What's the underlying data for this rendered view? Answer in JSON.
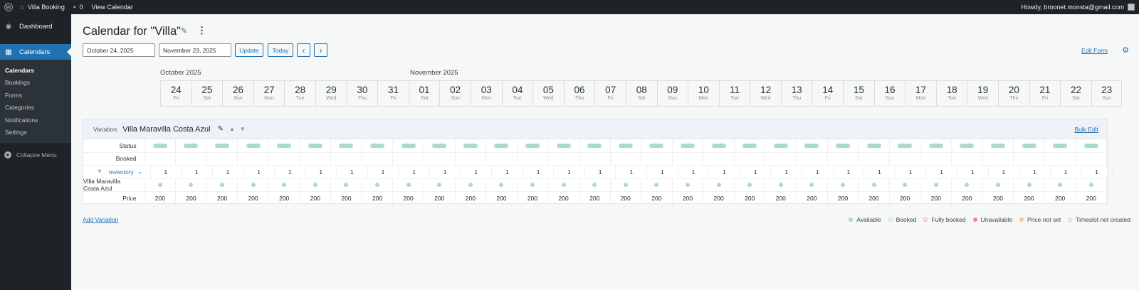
{
  "adminbar": {
    "site_name": "Villa Booking",
    "comments_count": "0",
    "view_calendar": "View Calendar",
    "howdy": "Howdy, broonet.monsta@gmail.com"
  },
  "sidebar": {
    "dashboard": "Dashboard",
    "calendars": "Calendars",
    "submenu": [
      "Calendars",
      "Bookings",
      "Forms",
      "Categories",
      "Notifications",
      "Settings"
    ],
    "collapse": "Collapse Menu"
  },
  "page": {
    "title": "Calendar for \"Villa\"",
    "start_date": "October 24, 2025",
    "end_date": "November 23, 2025",
    "update_label": "Update",
    "today_label": "Today",
    "prev_label": "‹",
    "next_label": "›",
    "edit_form": "Edit Form",
    "months": [
      "October 2025",
      "November 2025"
    ]
  },
  "days": [
    {
      "num": "24",
      "wd": "Fri"
    },
    {
      "num": "25",
      "wd": "Sat"
    },
    {
      "num": "26",
      "wd": "Sun"
    },
    {
      "num": "27",
      "wd": "Mon"
    },
    {
      "num": "28",
      "wd": "Tue"
    },
    {
      "num": "29",
      "wd": "Wed"
    },
    {
      "num": "30",
      "wd": "Thu"
    },
    {
      "num": "31",
      "wd": "Fri"
    },
    {
      "num": "01",
      "wd": "Sat"
    },
    {
      "num": "02",
      "wd": "Sun"
    },
    {
      "num": "03",
      "wd": "Mon"
    },
    {
      "num": "04",
      "wd": "Tue"
    },
    {
      "num": "05",
      "wd": "Wed"
    },
    {
      "num": "06",
      "wd": "Thu"
    },
    {
      "num": "07",
      "wd": "Fri"
    },
    {
      "num": "08",
      "wd": "Sat"
    },
    {
      "num": "09",
      "wd": "Sun"
    },
    {
      "num": "10",
      "wd": "Mon"
    },
    {
      "num": "11",
      "wd": "Tue"
    },
    {
      "num": "12",
      "wd": "Wed"
    },
    {
      "num": "13",
      "wd": "Thu"
    },
    {
      "num": "14",
      "wd": "Fri"
    },
    {
      "num": "15",
      "wd": "Sat"
    },
    {
      "num": "16",
      "wd": "Sun"
    },
    {
      "num": "17",
      "wd": "Mon"
    },
    {
      "num": "18",
      "wd": "Tue"
    },
    {
      "num": "19",
      "wd": "Wed"
    },
    {
      "num": "20",
      "wd": "Thu"
    },
    {
      "num": "21",
      "wd": "Fri"
    },
    {
      "num": "22",
      "wd": "Sat"
    },
    {
      "num": "23",
      "wd": "Sun"
    }
  ],
  "variation": {
    "label": "Variation:",
    "name": "Villa Maravilla Costa Azul",
    "bulk_edit": "Bulk Edit",
    "rows": {
      "status": "Status",
      "booked": "Booked",
      "inventory": "Inventory",
      "unit": "Villa Maravilla Costa Azul",
      "price": "Price"
    },
    "inventory_value": "1",
    "price_value": "200",
    "status_color": "#a8dcc6"
  },
  "add_variation": "Add Variation",
  "legend": [
    {
      "label": "Available",
      "color": "#a8dcc6",
      "filled": true
    },
    {
      "label": "Booked",
      "color": "#a8dcc6",
      "filled": false
    },
    {
      "label": "Fully booked",
      "color": "#f0a0a0",
      "filled": false
    },
    {
      "label": "Unavailable",
      "color": "#f08a8a",
      "filled": true
    },
    {
      "label": "Price not set",
      "color": "#f5c59a",
      "filled": true
    },
    {
      "label": "Timeslot not created",
      "color": "#c3c4c7",
      "filled": false
    }
  ]
}
